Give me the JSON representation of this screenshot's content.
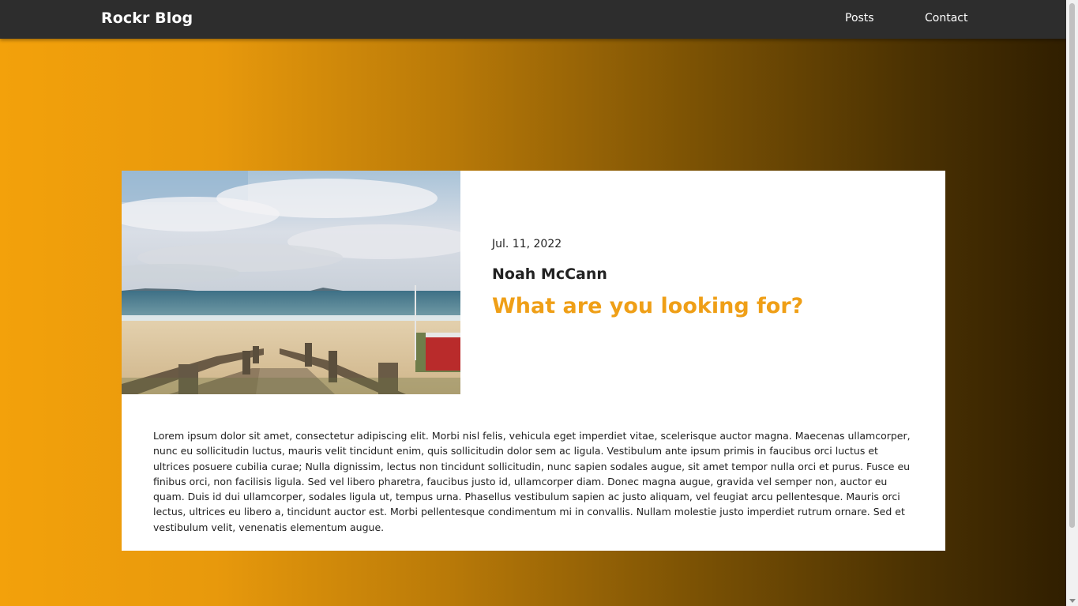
{
  "header": {
    "brand": "Rockr Blog",
    "nav": [
      "Posts",
      "Contact"
    ]
  },
  "post": {
    "date": "Jul. 11, 2022",
    "author": "Noah McCann",
    "title": "What are you looking for?",
    "image_alt": "beach-boardwalk-photo",
    "body": "Lorem ipsum dolor sit amet, consectetur adipiscing elit. Morbi nisl felis, vehicula eget imperdiet vitae, scelerisque auctor magna. Maecenas ullamcorper, nunc eu sollicitudin luctus, mauris velit tincidunt enim, quis sollicitudin dolor sem ac ligula. Vestibulum ante ipsum primis in faucibus orci luctus et ultrices posuere cubilia curae; Nulla dignissim, lectus non tincidunt sollicitudin, nunc sapien sodales augue, sit amet tempor nulla orci et purus. Fusce eu finibus orci, non facilisis ligula. Sed vel libero pharetra, faucibus justo id, ullamcorper diam. Donec magna augue, gravida vel semper non, auctor eu quam. Duis id dui ullamcorper, sodales ligula ut, tempus urna. Phasellus vestibulum sapien ac justo aliquam, vel feugiat arcu pellentesque. Mauris orci lectus, ultrices eu libero a, tincidunt auctor est. Morbi pellentesque condimentum mi in convallis. Nullam molestie justo imperdiet rutrum ornare. Sed et vestibulum velit, venenatis elementum augue."
  },
  "colors": {
    "accent": "#ef9f17",
    "topbar": "#2d2d2d",
    "gradient_start": "#f3a10b",
    "gradient_end": "#2e1d00"
  }
}
